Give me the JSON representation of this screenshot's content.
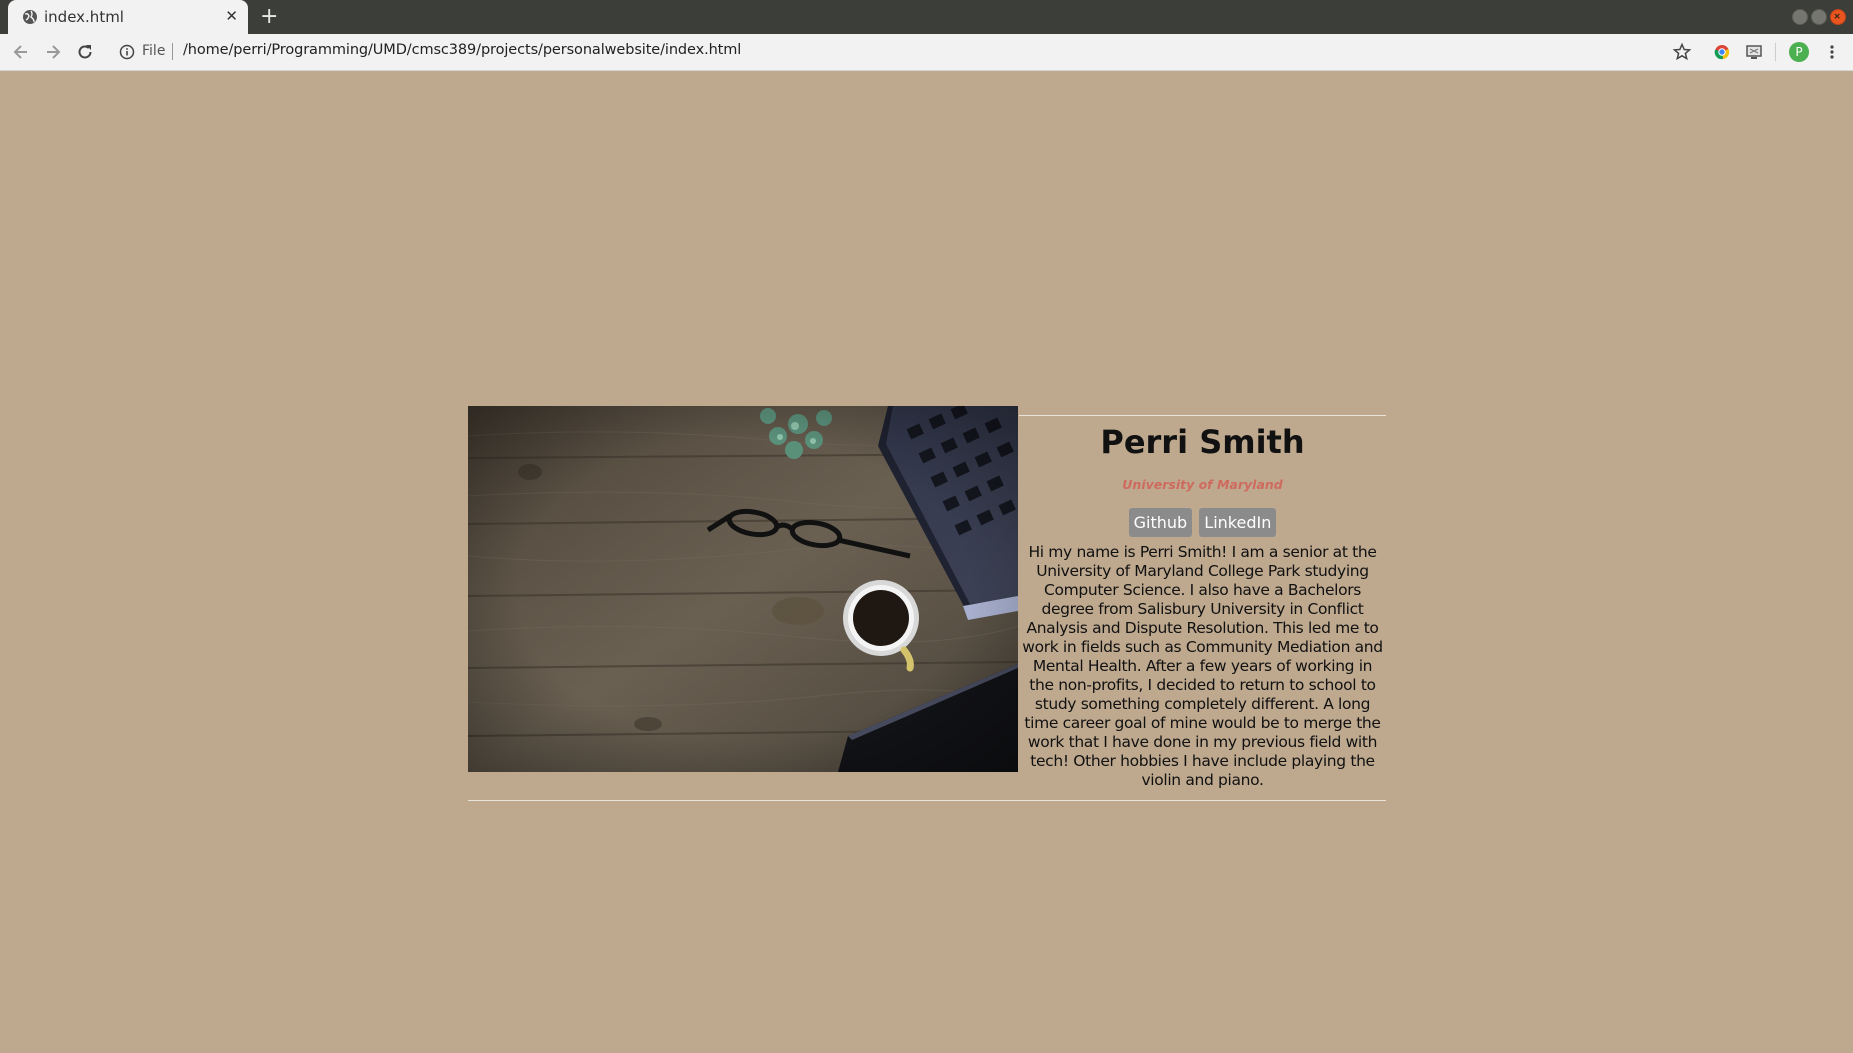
{
  "browser": {
    "tab_title": "index.html",
    "tab_close": "✕",
    "new_tab": "+",
    "omnibox_scheme": "File",
    "url": "/home/perri/Programming/UMD/cmsc389/projects/personalwebsite/index.html",
    "profile_initial": "P"
  },
  "profile": {
    "name": "Perri Smith",
    "school": "University of Maryland",
    "links": [
      "Github",
      "LinkedIn"
    ],
    "bio": "Hi my name is Perri Smith! I am a senior at the University of Maryland College Park studying Computer Science. I also have a Bachelors degree from Salisbury University in Conflict Analysis and Dispute Resolution. This led me to work in fields such as Community Mediation and Mental Health. After a few years of working in the non-profits, I decided to return to school to study something completely different. A long time career goal of mine would be to merge the work that I have done in my previous field with tech! Other hobbies I have include playing the violin and piano."
  },
  "colors": {
    "page_background": "#bea98f",
    "school_text": "#cf6a5e",
    "button_background": "#8b8b8b"
  }
}
